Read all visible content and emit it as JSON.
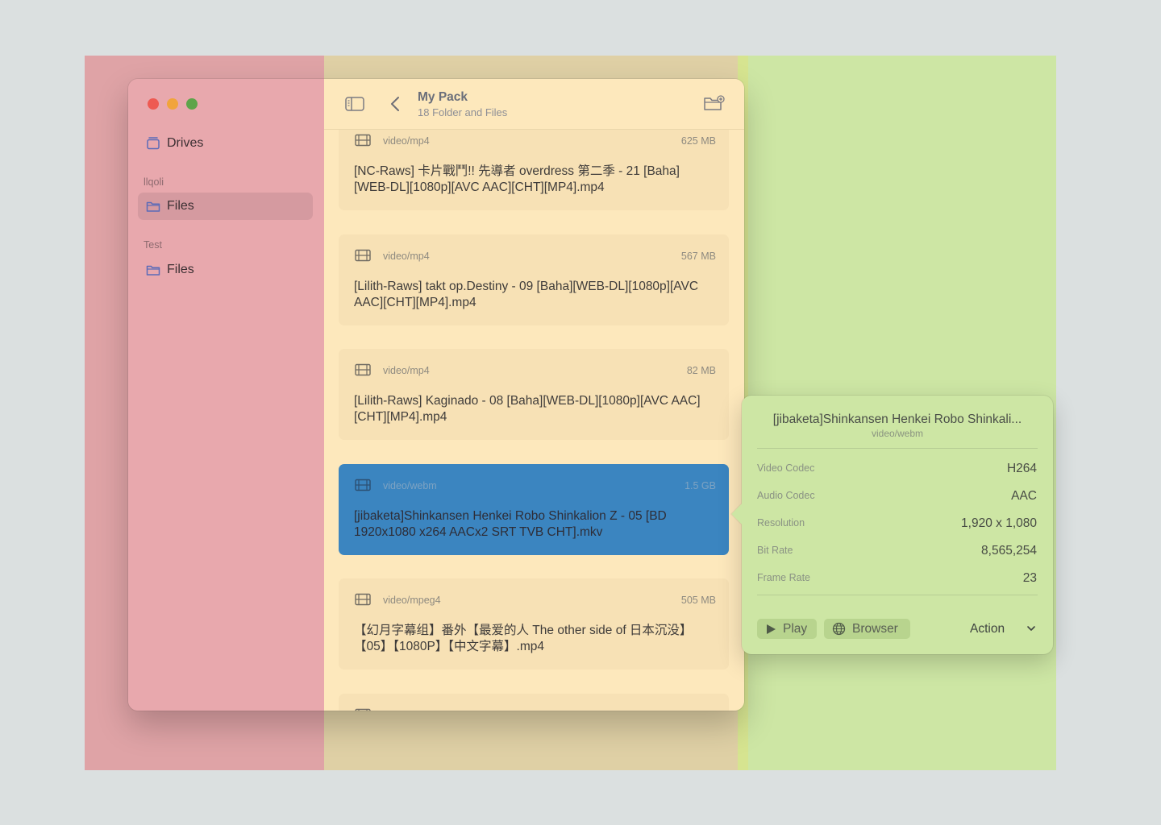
{
  "sidebar": {
    "drives_label": "Drives",
    "sections": [
      {
        "header": "llqoli",
        "item_label": "Files"
      },
      {
        "header": "Test",
        "item_label": "Files"
      }
    ]
  },
  "toolbar": {
    "title": "My Pack",
    "subtitle": "18 Folder and Files"
  },
  "files": [
    {
      "mime": "video/mp4",
      "size": "625 MB",
      "name": "[NC-Raws] 卡片戰鬥!! 先導者 overdress 第二季 - 21 [Baha][WEB-DL][1080p][AVC AAC][CHT][MP4].mp4"
    },
    {
      "mime": "video/mp4",
      "size": "567 MB",
      "name": "[Lilith-Raws] takt op.Destiny - 09 [Baha][WEB-DL][1080p][AVC AAC][CHT][MP4].mp4"
    },
    {
      "mime": "video/mp4",
      "size": "82 MB",
      "name": "[Lilith-Raws] Kaginado - 08 [Baha][WEB-DL][1080p][AVC AAC][CHT][MP4].mp4"
    },
    {
      "mime": "video/webm",
      "size": "1.5 GB",
      "name": "[jibaketa]Shinkansen Henkei Robo Shinkalion Z - 05 [BD 1920x1080 x264 AACx2 SRT TVB CHT].mkv"
    },
    {
      "mime": "video/mpeg4",
      "size": "505 MB",
      "name": "【幻月字幕组】番外【最爱的人 The other side of 日本沉没】【05】【1080P】【中文字幕】.mp4"
    }
  ],
  "details": {
    "title": "[jibaketa]Shinkansen Henkei Robo Shinkali...",
    "mime": "video/webm",
    "properties": [
      {
        "label": "Video Codec",
        "value": "H264"
      },
      {
        "label": "Audio Codec",
        "value": "AAC"
      },
      {
        "label": "Resolution",
        "value": "1,920 x 1,080"
      },
      {
        "label": "Bit Rate",
        "value": "8,565,254"
      },
      {
        "label": "Frame Rate",
        "value": "23"
      }
    ],
    "play_label": "Play",
    "browser_label": "Browser",
    "action_label": "Action"
  }
}
